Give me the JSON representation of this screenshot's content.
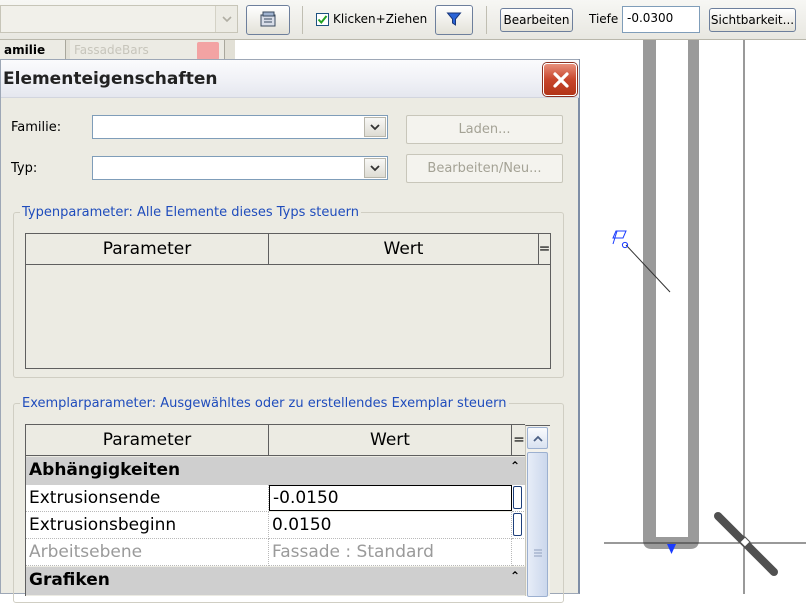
{
  "toolbar": {
    "type_combo_value": "",
    "checkbox_label": "Klicken+Ziehen",
    "checkbox_checked": true,
    "edit_button_label": "Bearbeiten",
    "depth_label": "Tiefe",
    "depth_value": "-0.0300",
    "visibility_button_label": "Sichtbarkeit..."
  },
  "tabs": [
    {
      "label": "amilie"
    },
    {
      "label": "FassadeBars"
    }
  ],
  "dialog": {
    "title": "Elementeigenschaften",
    "family_label": "Familie:",
    "family_value": "",
    "type_label": "Typ:",
    "type_value": "",
    "load_button": "Laden...",
    "edit_new_button": "Bearbeiten/Neu...",
    "type_params_title": "Typenparameter: Alle Elemente dieses Typs steuern",
    "type_grid": {
      "col_parameter": "Parameter",
      "col_value": "Wert",
      "col_eq": "="
    },
    "instance_params_title": "Exemplarparameter: Ausgewähltes oder zu erstellendes Exemplar steuern",
    "instance_grid": {
      "col_parameter": "Parameter",
      "col_value": "Wert",
      "col_eq": "=",
      "group_1": "Abhängigkeiten",
      "rows": [
        {
          "parameter": "Extrusionsende",
          "value": "-0.0150"
        },
        {
          "parameter": "Extrusionsbeginn",
          "value": "0.0150"
        },
        {
          "parameter": "Arbeitsebene",
          "value": "Fassade : Standard"
        }
      ],
      "group_2": "Grafiken"
    }
  },
  "colors": {
    "groupbox_title": "#1f4cbc",
    "close_button": "#c8452c",
    "canvas_element": "#9a9a9a",
    "marker_blue": "#1a3cff"
  },
  "icons": {
    "combo_arrow": "chevron-down-icon",
    "properties_button": "properties-icon",
    "filter_button": "filter-icon",
    "close": "close-icon",
    "work_plane_marker": "work-plane-icon"
  }
}
